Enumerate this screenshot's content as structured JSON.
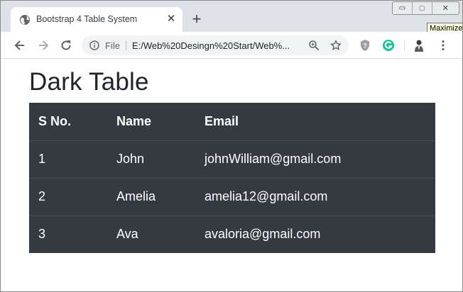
{
  "browser": {
    "tab": {
      "title": "Bootstrap 4 Table System",
      "close_label": "✕",
      "favicon": "globe-icon"
    },
    "new_tab_label": "+",
    "window_controls": {
      "minimize": "▭",
      "maximize": "□",
      "close": "✕"
    },
    "tooltip": "Maximize",
    "toolbar": {
      "file_label": "File",
      "url": "E:/Web%20Desingn%20Start/Web%...",
      "icons": [
        "back-arrow-icon",
        "forward-arrow-icon",
        "reload-icon",
        "info-icon",
        "zoom-icon",
        "star-icon",
        "shield-icon",
        "grammarly-icon",
        "profile-avatar-icon",
        "kebab-menu-icon"
      ]
    }
  },
  "page": {
    "title": "Dark Table",
    "table": {
      "headers": [
        "S No.",
        "Name",
        "Email"
      ],
      "rows": [
        [
          "1",
          "John",
          "johnWilliam@gmail.com"
        ],
        [
          "2",
          "Amelia",
          "amelia12@gmail.com"
        ],
        [
          "3",
          "Ava",
          "avaloria@gmail.com"
        ]
      ]
    }
  },
  "colors": {
    "tab_strip": "#dee1e6",
    "table_bg": "#343a40",
    "table_border": "#454d55",
    "grammarly": "#15c39a"
  }
}
